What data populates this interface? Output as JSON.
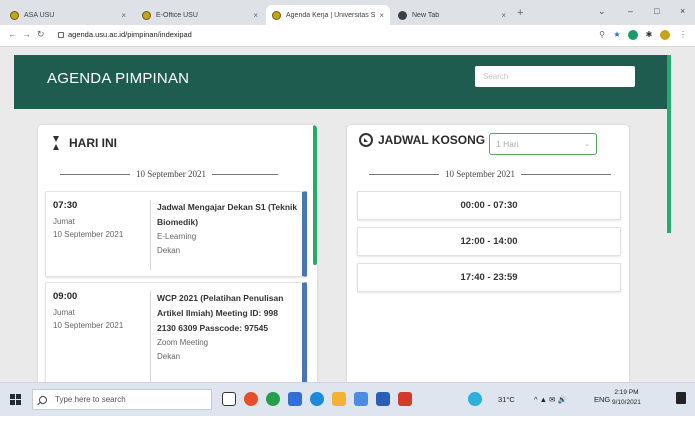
{
  "browser": {
    "tabs": [
      {
        "title": "ASA USU",
        "active": false
      },
      {
        "title": "E-Office USU",
        "active": false
      },
      {
        "title": "Agenda Kerja | Universitas Sumat",
        "active": true
      },
      {
        "title": "New Tab",
        "active": false
      }
    ],
    "tab_close": "×",
    "new_tab": "+",
    "url": "agenda.usu.ac.id/pimpinan/indexipad"
  },
  "header": {
    "title": "AGENDA PIMPINAN",
    "search_placeholder": "Search"
  },
  "today": {
    "heading": "HARI INI",
    "date": "10 September 2021",
    "events": [
      {
        "time": "07:30",
        "day": "Jumat",
        "date": "10 September 2021",
        "title": "Jadwal Mengajar Dekan S1 (Teknik Biomedik)",
        "location": "E-Learning",
        "person": "Dekan"
      },
      {
        "time": "09:00",
        "day": "Jumat",
        "date": "10 September 2021",
        "title": "WCP 2021 (Pelatihan Penulisan Artikel Ilmiah) Meeting ID: 998 2130 6309 Passcode: 97545",
        "location": "Zoom Meeting",
        "person": "Dekan"
      }
    ]
  },
  "free_schedule": {
    "heading": "JADWAL KOSONG",
    "range_selected": "1 Hari",
    "date": "10 September 2021",
    "slots": [
      "00:00 - 07:30",
      "12:00 - 14:00",
      "17:40 - 23:59"
    ]
  },
  "taskbar": {
    "search_placeholder": "Type here to search",
    "weather": "31°C",
    "language": "ENG",
    "time": "2:19 PM",
    "date": "9/10/2021"
  },
  "colors": {
    "header_bg": "#1e5c50",
    "accent_green": "#28a96e",
    "card_border_blue": "#4a76b0"
  }
}
